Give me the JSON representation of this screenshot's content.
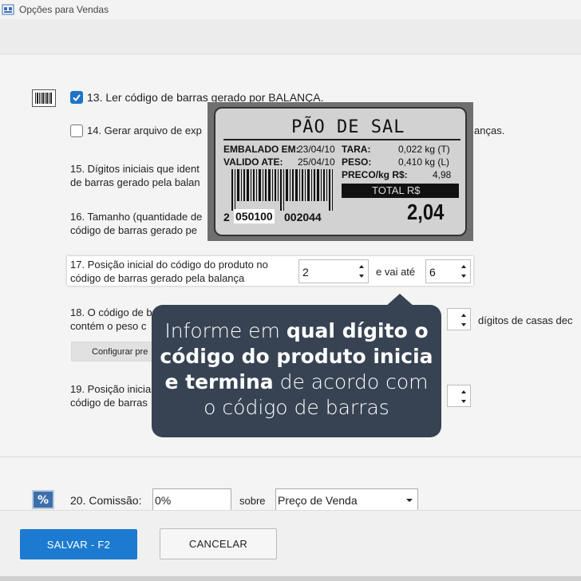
{
  "window": {
    "title": "Opções para Vendas"
  },
  "options": {
    "opt13": {
      "label": "13. Ler código de barras gerado por BALANÇA.",
      "checked": true
    },
    "opt14": {
      "label_start": "14. Gerar arquivo de exp",
      "label_end": "anças.",
      "checked": false
    },
    "opt15": {
      "line1": "15. Dígitos iniciais que ident",
      "line2": "de barras gerado pela balan"
    },
    "opt16": {
      "line1": "16. Tamanho (quantidade de",
      "line2": "código de barras gerado pe"
    },
    "opt17": {
      "line1": "17. Posição inicial do código do produto no",
      "line2": "código de barras gerado pela balança",
      "start_value": "2",
      "between_label": "e vai até",
      "end_value": "6"
    },
    "opt18": {
      "line1": "18. O código de b",
      "line2": "contém o peso c",
      "right_label": "dígitos de casas dec",
      "config_button": "Configurar pre"
    },
    "opt19": {
      "line1": "19. Posição inicia",
      "line2": "código de barras"
    },
    "opt20": {
      "label": "20. Comissão:",
      "value": "0%",
      "sobre": "sobre",
      "base": "Preço de Venda"
    }
  },
  "scale_label": {
    "product": "PÃO DE SAL",
    "embalado_label": "EMBALADO EM:",
    "embalado_date": "23/04/10",
    "valido_label": "VALIDO ATE:",
    "valido_date": "25/04/10",
    "tara_label": "TARA:",
    "tara_value": "0,022 kg (T)",
    "peso_label": "PESO:",
    "peso_value": "0,410 kg (L)",
    "preco_label": "PRECO/kg R$:",
    "preco_value": "4,98",
    "total_label": "TOTAL R$",
    "total_value": "2,04",
    "barcode_prefix": "2",
    "barcode_highlight": "050100",
    "barcode_suffix": "002044"
  },
  "tooltip": {
    "p1": "Informe em ",
    "b1": "qual dígito o",
    "b2": "código do produto inicia",
    "b3": "e termina",
    "p2": " de acordo com",
    "p3": "o código de barras"
  },
  "footer": {
    "save": "SALVAR - F2",
    "cancel": "CANCELAR"
  },
  "colors": {
    "primary": "#1c7bd1",
    "tooltip_bg": "#374353",
    "checkbox": "#1f74c9"
  }
}
